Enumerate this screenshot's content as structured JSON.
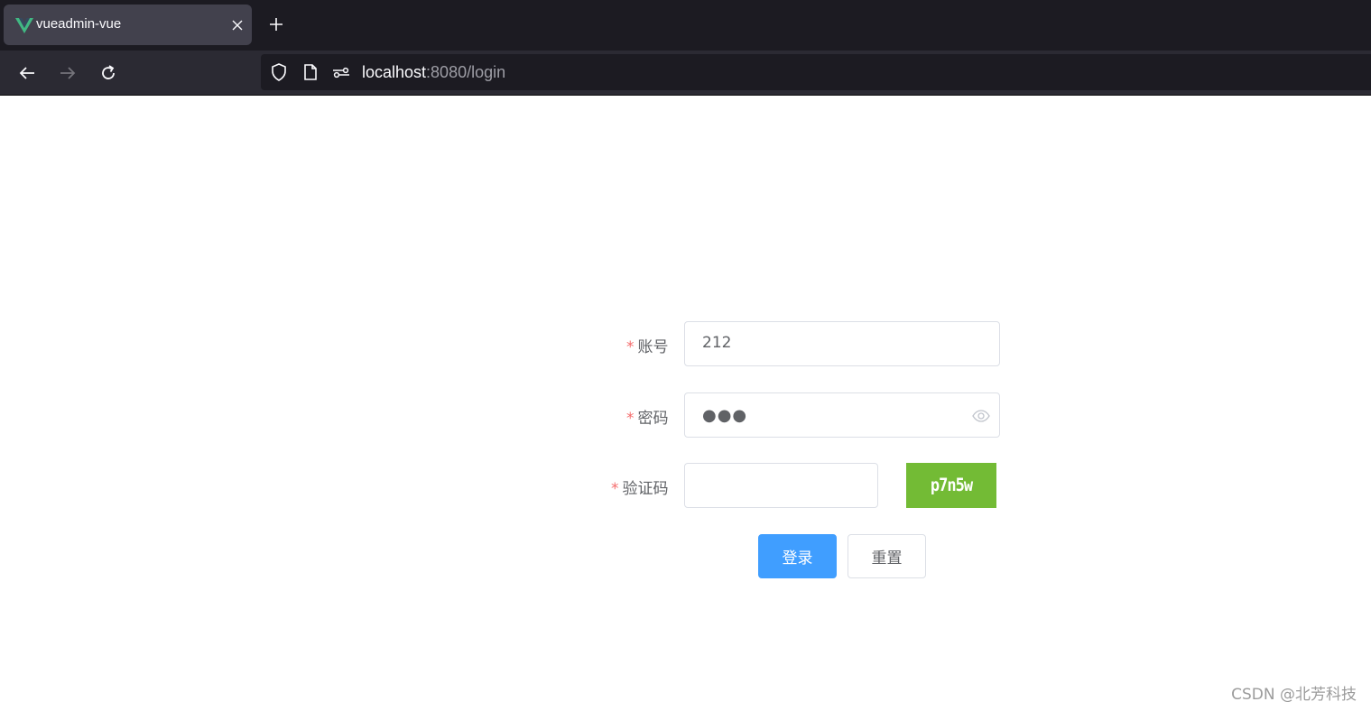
{
  "browser": {
    "tab": {
      "title": "vueadmin-vue",
      "favicon": "vue-logo-icon"
    },
    "url": {
      "host": "localhost",
      "rest": ":8080/login"
    }
  },
  "form": {
    "required_mark": "*",
    "username": {
      "label": "账号",
      "value": "212"
    },
    "password": {
      "label": "密码",
      "value": "●●●"
    },
    "captcha": {
      "label": "验证码",
      "value": "",
      "image_text": "p7n5w"
    },
    "buttons": {
      "login": "登录",
      "reset": "重置"
    }
  },
  "watermark": "CSDN @北芳科技",
  "colors": {
    "primary": "#409eff",
    "required": "#f56c6c",
    "captcha_bg": "#73bb35"
  }
}
